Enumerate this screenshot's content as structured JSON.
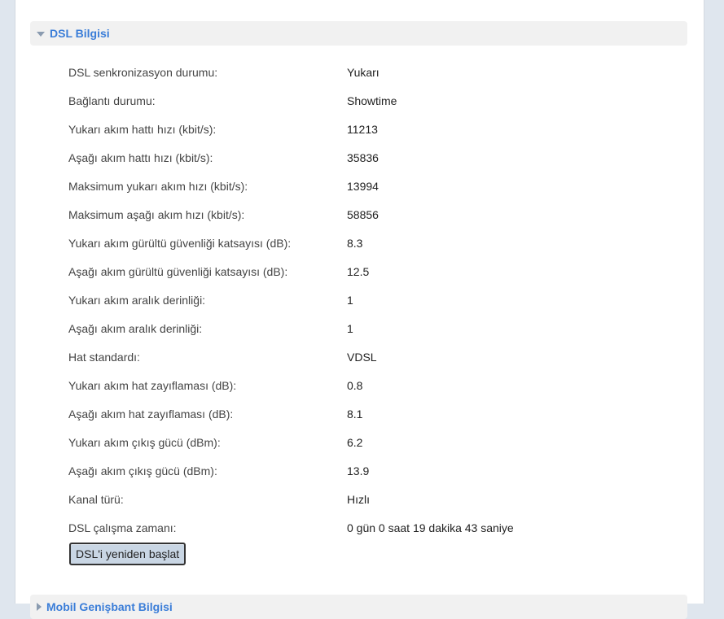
{
  "section": {
    "title": "DSL Bilgisi"
  },
  "rows": [
    {
      "label": "DSL senkronizasyon durumu:",
      "value": "Yukarı"
    },
    {
      "label": "Bağlantı durumu:",
      "value": "Showtime"
    },
    {
      "label": "Yukarı akım hattı hızı (kbit/s):",
      "value": "11213"
    },
    {
      "label": "Aşağı akım hattı hızı (kbit/s):",
      "value": "35836"
    },
    {
      "label": "Maksimum yukarı akım hızı (kbit/s):",
      "value": "13994"
    },
    {
      "label": "Maksimum aşağı akım hızı (kbit/s):",
      "value": "58856"
    },
    {
      "label": "Yukarı akım gürültü güvenliği katsayısı (dB):",
      "value": "8.3"
    },
    {
      "label": "Aşağı akım gürültü güvenliği katsayısı (dB):",
      "value": "12.5"
    },
    {
      "label": "Yukarı akım aralık derinliği:",
      "value": "1"
    },
    {
      "label": "Aşağı akım aralık derinliği:",
      "value": "1"
    },
    {
      "label": "Hat standardı:",
      "value": "VDSL"
    },
    {
      "label": "Yukarı akım hat zayıflaması (dB):",
      "value": "0.8"
    },
    {
      "label": "Aşağı akım hat zayıflaması (dB):",
      "value": "8.1"
    },
    {
      "label": "Yukarı akım çıkış gücü (dBm):",
      "value": "6.2"
    },
    {
      "label": "Aşağı akım çıkış gücü (dBm):",
      "value": "13.9"
    },
    {
      "label": "Kanal türü:",
      "value": "Hızlı"
    },
    {
      "label": "DSL çalışma zamanı:",
      "value": "0 gün 0 saat 19 dakika 43 saniye"
    }
  ],
  "restart_button": {
    "label": "DSL'i yeniden başlat"
  },
  "next_section": {
    "title": "Mobil Genişbant Bilgisi"
  },
  "colors": {
    "accent": "#3a7dd8",
    "header_bg": "#f1f1f1",
    "button_bg": "#c9d6e4"
  },
  "icons": {
    "section_toggle": "triangle-down-icon",
    "next_section_toggle": "triangle-right-icon"
  }
}
